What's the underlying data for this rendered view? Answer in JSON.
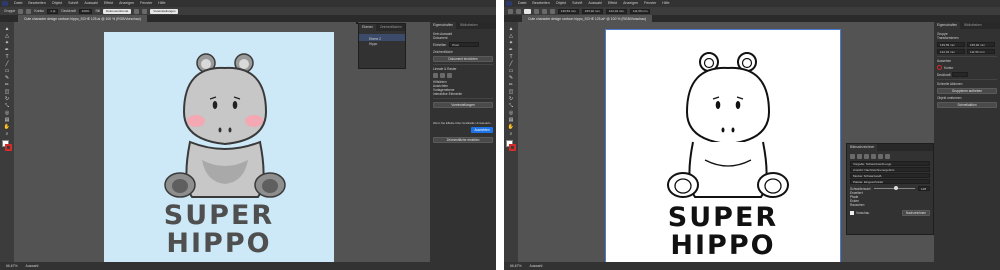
{
  "menu": [
    "Datei",
    "Bearbeiten",
    "Objekt",
    "Schrift",
    "Auswahl",
    "Effekt",
    "Anzeigen",
    "Fenster",
    "Hilfe"
  ],
  "left": {
    "control": {
      "group_label": "Gruppe",
      "stroke_label": "Kontur",
      "stroke_value": "1 pt",
      "opacity_label": "Deckkraft",
      "opacity_value": "100%",
      "style_label": "Stil",
      "document_settings": "Dokumentformat",
      "preferences": "Voreinstellungen"
    },
    "doc_tab": "Cute character design cartoon hippo_SCHE 125.ai @ 100 % (RGB/Vorschau)",
    "title_top": "SUPER",
    "title_bottom": "HIPPO",
    "zoom": "66,67%",
    "status": "Auswahl",
    "layers_panel": {
      "tabs": [
        "Ebenen",
        "Zeichenflächen"
      ],
      "rows": [
        "Ebene 2",
        "Hippo"
      ]
    },
    "properties": {
      "tabs": [
        "Eigenschaften",
        "Bibliotheken"
      ],
      "rows": [
        "Kein Auswahl",
        "Dokument",
        "Einheiten",
        "Pixel",
        "Zeichenfläche",
        "Dokument einrichten",
        "Voreinstellungen",
        "Lineale & Raster",
        "Hilfslinien",
        "Ausrichten",
        "Vorlagenebene",
        "Interaktive Elemente"
      ],
      "buttons": [
        "Dokument einrichten",
        "Voreinstellungen"
      ],
      "note": "Wenn Sie Effekte Oder Grafikstile Umwandeln...",
      "button_blue": "Ausrichten",
      "button_bottom": "Zeichenfläche erstellen"
    }
  },
  "right": {
    "control": {
      "field_x": "139,59 mm",
      "field_y": "165,92 mm",
      "field_w": "122,04 mm",
      "field_h": "111,56 mm"
    },
    "doc_tab": "Cute character design cartoon hippo_SCHE 125.ai* @ 100 % (RGB/Vorschau)",
    "title_top": "SUPER",
    "title_bottom": "HIPPO",
    "zoom": "66,67%",
    "status": "Auswahl",
    "properties": {
      "tabs": [
        "Eigenschaften",
        "Bibliotheken"
      ],
      "rows": [
        "Gruppe",
        "Transformieren",
        "Aussehen",
        "Kontur",
        "Deckkraft",
        "Schnelle Aktionen",
        "Gruppieren aufheben",
        "Objekt umformen",
        "Schnellaktion"
      ]
    },
    "float_panel": {
      "title": "Bildnachzeichner",
      "rows": [
        "Vorgabe: Schwarzweiß-Logo",
        "Ansicht: Nachzeichnerergebnis",
        "Modus: Schwarzweiß",
        "Palette: Eingeschränkt",
        "Schwellenwert",
        "Erweitert",
        "Pfade",
        "Ecken",
        "Rauschen"
      ],
      "threshold_value": "128",
      "checkbox": "Vorschau",
      "button": "Nachzeichnen"
    }
  },
  "colors": {
    "chrome": "#535353",
    "panel": "#323232",
    "artboard_bg": "#cde9f8",
    "hippo_fill": "#c7c7c7",
    "hippo_dark": "#8e8e8e",
    "cheek": "#f4a8b3",
    "text_dark": "#4f4f4f",
    "black": "#111111"
  }
}
